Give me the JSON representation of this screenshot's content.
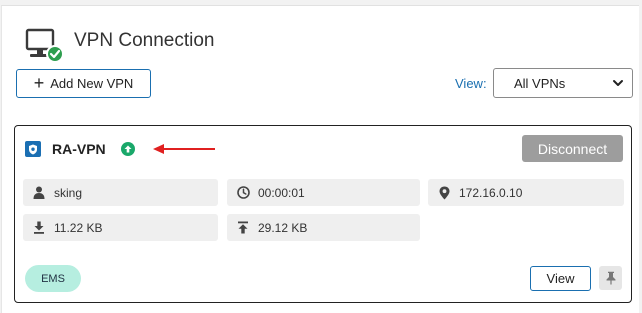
{
  "header": {
    "title": "VPN Connection",
    "icon": "computer-shield-icon"
  },
  "toolbar": {
    "add_label": "Add New VPN",
    "view_label": "View:",
    "view_selected": "All VPNs"
  },
  "connection": {
    "name": "RA-VPN",
    "status_icon": "connected-up-arrow-icon",
    "disconnect_label": "Disconnect",
    "user": "sking",
    "duration": "00:00:01",
    "ip": "172.16.0.10",
    "downloaded": "11.22 KB",
    "uploaded": "29.12 KB",
    "tag": "EMS",
    "view_label": "View"
  },
  "colors": {
    "accent": "#1a6fb0",
    "status_green": "#1aa86a",
    "arrow_red": "#e02020",
    "ems_badge": "#b6eee0",
    "disconnect_bg": "#9d9d9d"
  }
}
